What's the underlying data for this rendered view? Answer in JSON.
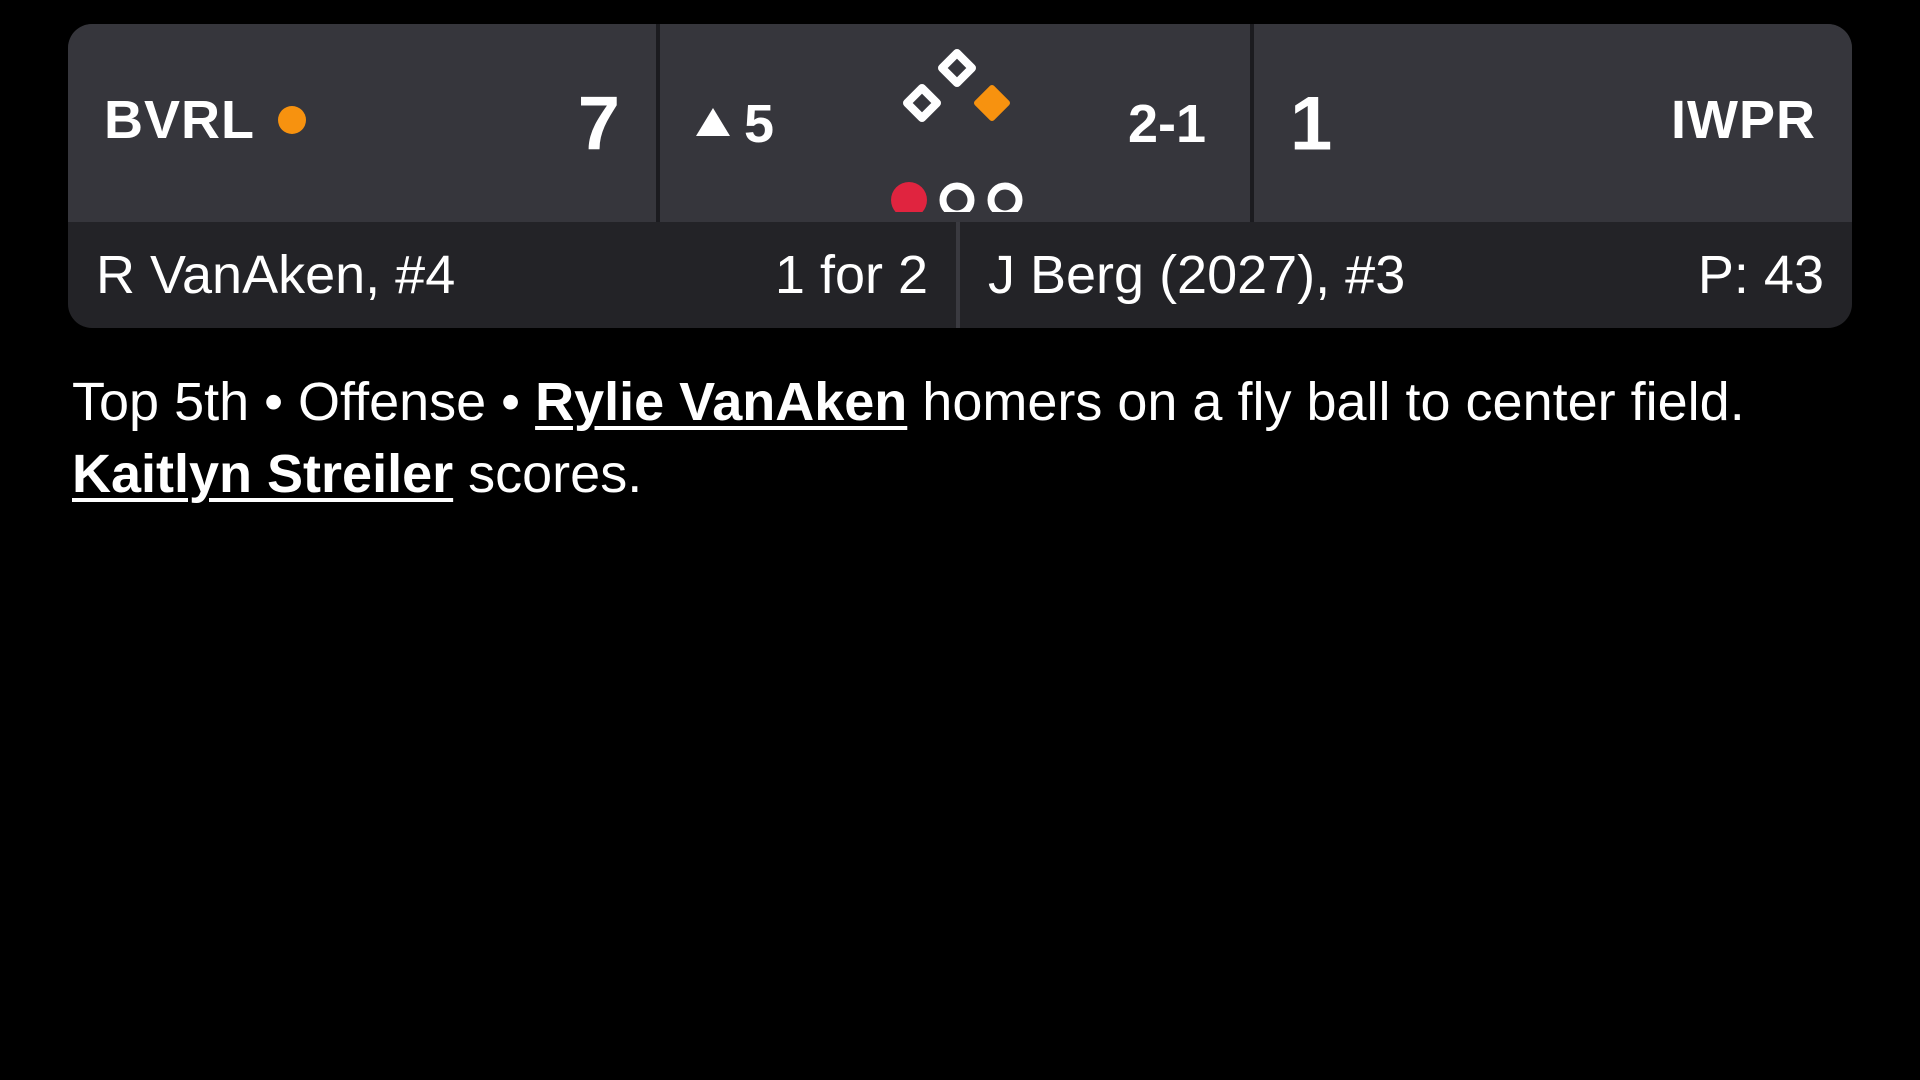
{
  "colors": {
    "accent_orange": "#f7920f",
    "out_red": "#e0243f",
    "panel_top": "#36363c",
    "panel_bottom": "#232327",
    "background": "#000000"
  },
  "scoreboard": {
    "away": {
      "abbr": "BVRL",
      "score": "7",
      "has_possession": true,
      "possession_icon": "possession-dot"
    },
    "inning": {
      "half": "top",
      "half_icon": "triangle-up-icon",
      "number": "5"
    },
    "bases": {
      "first": true,
      "second": false,
      "third": false
    },
    "outs": {
      "count": 1,
      "max": 3
    },
    "count": "2-1",
    "home": {
      "abbr": "IWPR",
      "score": "1"
    }
  },
  "matchup": {
    "batter": {
      "name": "R VanAken, #4",
      "stat": "1 for 2"
    },
    "pitcher": {
      "name": "J Berg (2027), #3",
      "stat": "P: 43"
    }
  },
  "play": {
    "prefix": "Top 5th • Offense • ",
    "player1": "Rylie VanAken",
    "middle": " homers on a fly ball to center field. ",
    "player2": "Kaitlyn Streiler",
    "suffix": " scores."
  }
}
